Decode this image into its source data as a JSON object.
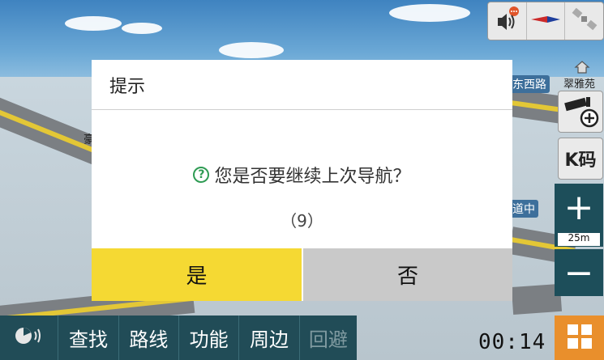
{
  "map": {
    "road_label_1": "东西路",
    "road_label_2": "道中",
    "place_label": "翠雅苑",
    "edge_char": "豪",
    "scale": "25m"
  },
  "top_controls": {
    "items": [
      {
        "icon": "speaker-icon"
      },
      {
        "icon": "compass-icon"
      },
      {
        "icon": "satellite-icon"
      }
    ]
  },
  "side_controls": {
    "kcode_label": "K码",
    "zoom_in": "+",
    "zoom_out": "−"
  },
  "bottom_bar": {
    "items": [
      {
        "label": ""
      },
      {
        "label": "查找"
      },
      {
        "label": "路线"
      },
      {
        "label": "功能"
      },
      {
        "label": "周边"
      },
      {
        "label": "回避"
      }
    ]
  },
  "status": {
    "time": "00:14"
  },
  "dialog": {
    "title": "提示",
    "message": "您是否要继续上次导航？",
    "countdown": "（9）",
    "yes": "是",
    "no": "否"
  },
  "colors": {
    "yes_button": "#f5d933",
    "no_button": "#c9c9c9",
    "bottom_bar": "#214c57",
    "menu_button": "#e98f2c",
    "question_icon": "#2e9b53"
  }
}
